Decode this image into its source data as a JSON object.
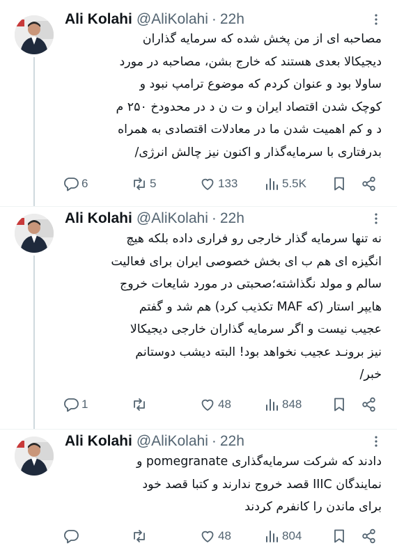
{
  "tweets": [
    {
      "name": "Ali Kolahi",
      "handle": "@AliKolahi",
      "separator": "·",
      "time": "22h",
      "lines": [
        "مصاحبه ای از من پخش شده که سرمایه گذاران",
        "دیجیکالا بعدی هستند که خارج بشن، مصاحبه در مورد",
        "ساولا بود و عنوان کردم که موضوع ترامپ نبود و",
        "کوچک شدن اقتصاد ایران و ت ن د در محدودخ ۲۵۰ م",
        "د و کم اهمیت شدن ما در معادلات اقتصادی به همراه",
        "بدرفتاری با سرمایه‌گذار و اکنون نیز چالش انرژی/"
      ],
      "replies": "6",
      "reposts": "5",
      "likes": "133",
      "views": "5.5K"
    },
    {
      "name": "Ali Kolahi",
      "handle": "@AliKolahi",
      "separator": "·",
      "time": "22h",
      "lines": [
        "نه تنها سرمایه گذار خارجی رو فراری داده بلکه هیچ",
        "انگیزه ای هم ب ای بخش خصوصی ایران برای فعالیت",
        "سالم و مولد نگذاشته؛صحبتی در مورد شایعات خروج",
        "هایپر استار (که MAF تکذیب کرد) هم شد و گفتم",
        "عجیب نیست و اگر سرمایه گذاران خارجی دیجیکالا",
        "نیز برونـد عجیب نخواهد بود! البته دیشب دوستانم",
        "خبر/"
      ],
      "replies": "1",
      "reposts": "",
      "likes": "48",
      "views": "848"
    },
    {
      "name": "Ali Kolahi",
      "handle": "@AliKolahi",
      "separator": "·",
      "time": "22h",
      "lines": [
        "دادند که شرکت سرمایه‌گذاری pomegranate و",
        "نمایندگان IIIC قصد خروج ندارند و کتبا قصد خود",
        "برای ماندن را کانفرم کردند"
      ],
      "replies": "",
      "reposts": "",
      "likes": "48",
      "views": "804"
    }
  ]
}
